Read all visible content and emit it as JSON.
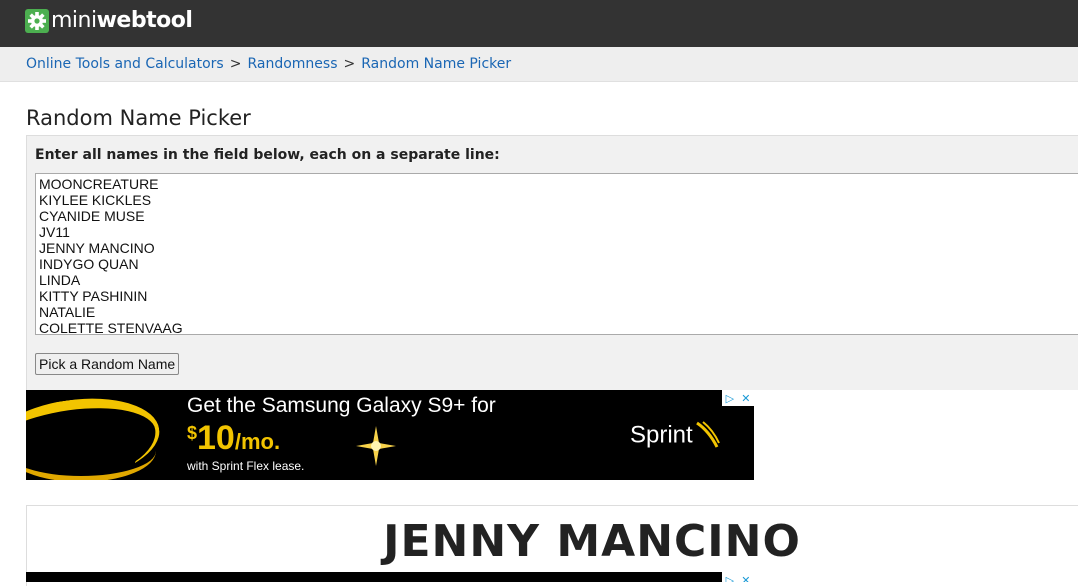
{
  "header": {
    "logo_light": "mini",
    "logo_bold": "webtool",
    "logo_icon": "gear-icon"
  },
  "breadcrumb": {
    "items": [
      "Online Tools and Calculators",
      "Randomness",
      "Random Name Picker"
    ],
    "separator": ">"
  },
  "page": {
    "title": "Random Name Picker"
  },
  "form": {
    "label": "Enter all names in the field below, each on a separate line:",
    "names": [
      "MOONCREATURE",
      "KIYLEE KICKLES",
      "CYANIDE MUSE",
      "JV11",
      "JENNY MANCINO",
      "INDYGO QUAN",
      "LINDA",
      "KITTY PASHININ",
      "NATALIE",
      "COLETTE STENVAAG"
    ],
    "button_label": "Pick a Random Name"
  },
  "ad": {
    "headline": "Get the Samsung Galaxy S9+ for",
    "price_symbol": "$",
    "price_amount": "10",
    "price_unit": "/mo.",
    "subtext": "with Sprint Flex lease.",
    "brand": "Sprint",
    "choices_icon": "ad-choices-icon",
    "close_icon": "close-icon"
  },
  "result": {
    "name": "JENNY MANCINO"
  },
  "colors": {
    "topbar": "#333333",
    "link": "#1a66b4",
    "logo_green": "#4caf50",
    "ad_yellow": "#f2c400"
  }
}
